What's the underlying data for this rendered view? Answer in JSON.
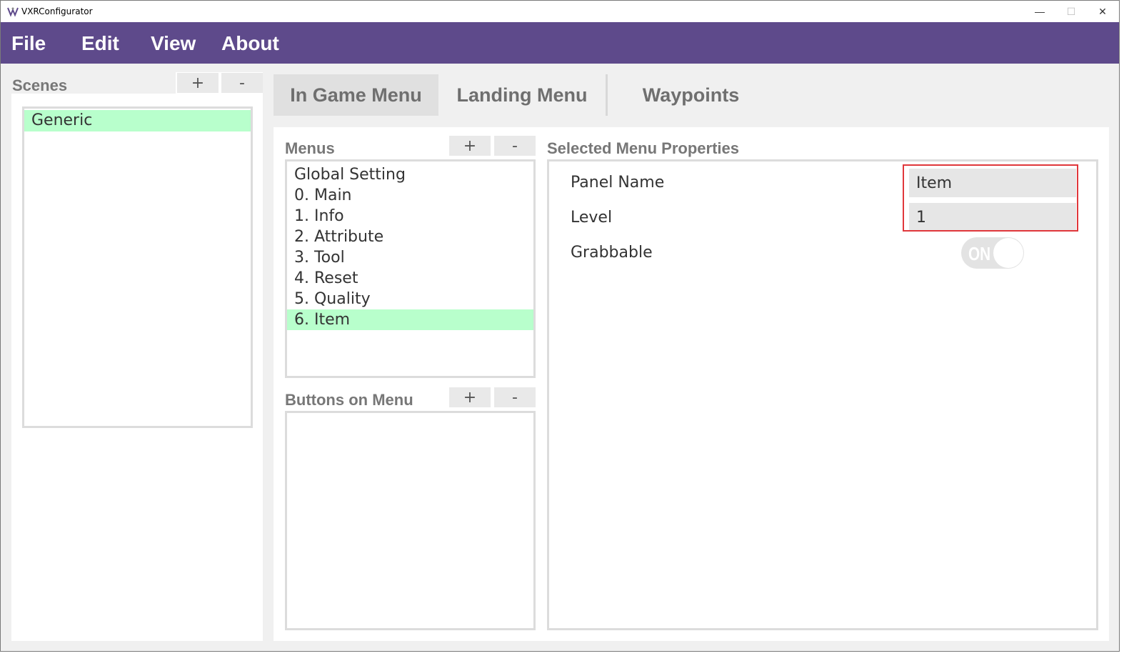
{
  "window": {
    "title": "VXRConfigurator"
  },
  "window_controls": {
    "minimize": "—",
    "maximize": "☐",
    "close": "✕"
  },
  "menubar": {
    "items": [
      "File",
      "Edit",
      "View",
      "About"
    ]
  },
  "scenes": {
    "label": "Scenes",
    "add_label": "+",
    "remove_label": "-",
    "items": [
      "Generic"
    ],
    "selected": "Generic"
  },
  "tabs": [
    "In Game Menu",
    "Landing Menu",
    "Waypoints"
  ],
  "active_tab": "In Game Menu",
  "menus": {
    "label": "Menus",
    "add_label": "+",
    "remove_label": "-",
    "items": [
      "Global Setting",
      "0. Main",
      "1. Info",
      "2. Attribute",
      "3. Tool",
      "4. Reset",
      "5. Quality",
      "6. Item"
    ],
    "selected": "6. Item"
  },
  "buttons_on_menu": {
    "label": "Buttons on Menu",
    "add_label": "+",
    "remove_label": "-",
    "items": []
  },
  "properties": {
    "label": "Selected Menu Properties",
    "panel_name_label": "Panel Name",
    "panel_name_value": "Item",
    "level_label": "Level",
    "level_value": "1",
    "grabbable_label": "Grabbable",
    "grabbable_state": "ON"
  },
  "colors": {
    "menubar": "#5e4a8b",
    "selection": "#b8ffcc",
    "highlight_box": "#e0373b"
  }
}
